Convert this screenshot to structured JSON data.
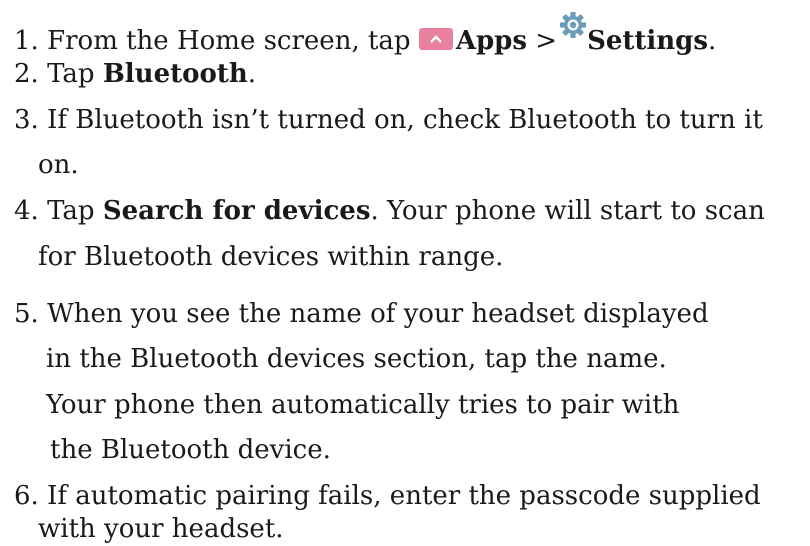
{
  "steps": {
    "s1": {
      "prefix": "1. From the Home screen, tap ",
      "apps": "Apps",
      "sep": " >",
      "settings": "Settings",
      "end": "."
    },
    "s2": {
      "prefix": "2. Tap ",
      "bold": "Bluetooth",
      "end": "."
    },
    "s3": {
      "line1": "3. If Bluetooth isn’t turned on, check Bluetooth to turn it",
      "line2": "on."
    },
    "s4": {
      "prefix": "4. Tap ",
      "bold": "Search for devices",
      "rest": ". Your phone will start to scan",
      "line2": "for Bluetooth devices within range."
    },
    "s5": {
      "line1": "5. When you see the name of your headset displayed",
      "line2": "in the Bluetooth devices section, tap the name.",
      "line3": "Your phone then automatically tries to pair with",
      "line4": "the Bluetooth device."
    },
    "s6": {
      "line1": "6. If automatic pairing fails, enter the passcode supplied",
      "line2": "with your headset."
    }
  },
  "icons": {
    "apps": "apps-chevron-up-icon",
    "settings": "gear-icon",
    "apps_color": "#e9819e",
    "gear_color": "#6a9bb8"
  }
}
